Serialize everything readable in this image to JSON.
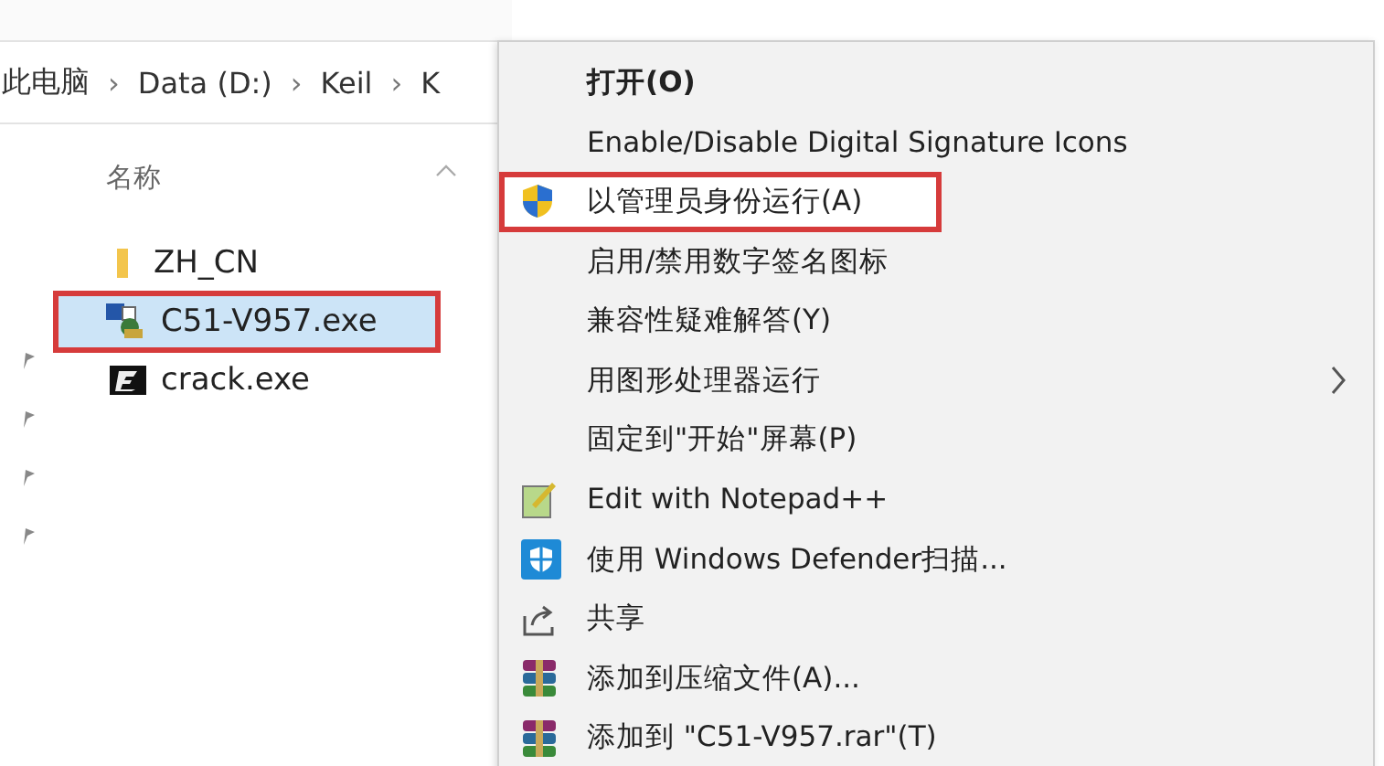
{
  "breadcrumb": [
    {
      "label": "此电脑"
    },
    {
      "separator": "›",
      "label": "Data (D:)"
    },
    {
      "separator": "›",
      "label": "Keil"
    },
    {
      "separator": "›",
      "label": "K"
    }
  ],
  "column_header": "名称",
  "files": [
    {
      "name": "ZH_CN",
      "kind": "folder",
      "selected": false,
      "annotated": false
    },
    {
      "name": "C51-V957.exe",
      "kind": "installer",
      "selected": true,
      "annotated": true
    },
    {
      "name": "crack.exe",
      "kind": "crack",
      "selected": false,
      "annotated": false
    }
  ],
  "context_menu": [
    {
      "label": "打开(O)",
      "bold": true,
      "kind": "plain",
      "highlighted": false,
      "annotated": false,
      "submenu": false
    },
    {
      "label": "Enable/Disable Digital Signature Icons",
      "bold": false,
      "kind": "plain",
      "highlighted": false,
      "annotated": false,
      "submenu": false
    },
    {
      "label": "以管理员身份运行(A)",
      "bold": false,
      "kind": "uac",
      "highlighted": true,
      "annotated": true,
      "submenu": false
    },
    {
      "label": "启用/禁用数字签名图标",
      "bold": false,
      "kind": "plain",
      "highlighted": false,
      "annotated": false,
      "submenu": false
    },
    {
      "label": "兼容性疑难解答(Y)",
      "bold": false,
      "kind": "plain",
      "highlighted": false,
      "annotated": false,
      "submenu": false
    },
    {
      "label": "用图形处理器运行",
      "bold": false,
      "kind": "plain",
      "highlighted": false,
      "annotated": false,
      "submenu": true
    },
    {
      "label": "固定到\"开始\"屏幕(P)",
      "bold": false,
      "kind": "plain",
      "highlighted": false,
      "annotated": false,
      "submenu": false
    },
    {
      "label": "Edit with Notepad++",
      "bold": false,
      "kind": "notepad",
      "highlighted": false,
      "annotated": false,
      "submenu": false
    },
    {
      "label": "使用 Windows Defender扫描...",
      "bold": false,
      "kind": "defender",
      "highlighted": false,
      "annotated": false,
      "submenu": false
    },
    {
      "label": "共享",
      "bold": false,
      "kind": "share",
      "highlighted": false,
      "annotated": false,
      "submenu": false
    },
    {
      "label": "添加到压缩文件(A)...",
      "bold": false,
      "kind": "archive",
      "highlighted": false,
      "annotated": false,
      "submenu": false
    },
    {
      "label": "添加到 \"C51-V957.rar\"(T)",
      "bold": false,
      "kind": "archive",
      "highlighted": false,
      "annotated": false,
      "submenu": false
    }
  ]
}
